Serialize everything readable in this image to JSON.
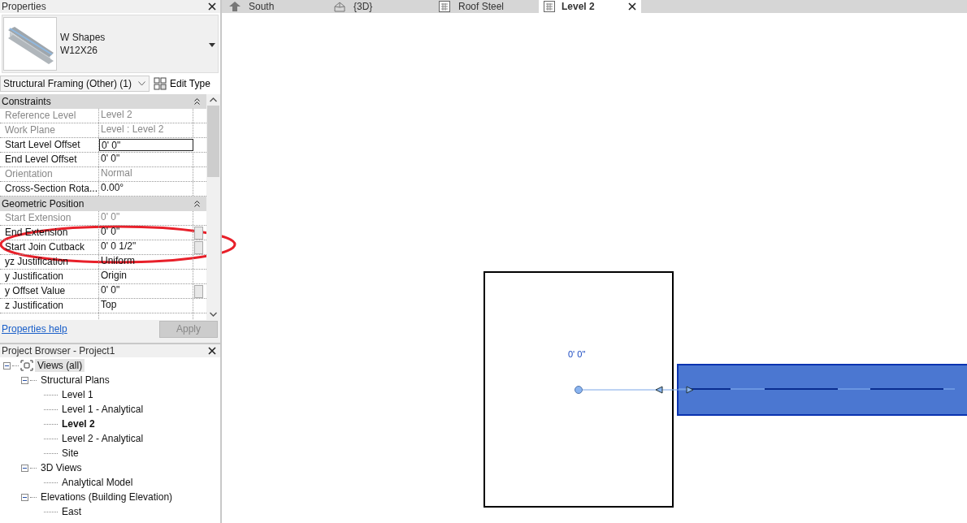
{
  "properties": {
    "title": "Properties",
    "type_family": "W Shapes",
    "type_name": "W12X26",
    "category_selector": "Structural Framing (Other) (1)",
    "edit_type": "Edit Type",
    "sections": [
      {
        "title": "Constraints",
        "expanded": true,
        "rows": [
          {
            "label": "Reference Level",
            "value": "Level 2",
            "disabled": true,
            "editing": false,
            "param_button": false
          },
          {
            "label": "Work Plane",
            "value": "Level : Level 2",
            "disabled": true,
            "editing": false,
            "param_button": false
          },
          {
            "label": "Start Level Offset",
            "value": "0'  0\"",
            "disabled": false,
            "editing": true,
            "param_button": false
          },
          {
            "label": "End Level Offset",
            "value": "0'  0\"",
            "disabled": false,
            "editing": false,
            "param_button": false
          },
          {
            "label": "Orientation",
            "value": "Normal",
            "disabled": true,
            "editing": false,
            "param_button": false
          },
          {
            "label": "Cross-Section Rota...",
            "value": "0.00°",
            "disabled": false,
            "editing": false,
            "param_button": false
          }
        ]
      },
      {
        "title": "Geometric Position",
        "expanded": true,
        "rows": [
          {
            "label": "Start Extension",
            "value": "0'  0\"",
            "disabled": true,
            "editing": false,
            "param_button": false
          },
          {
            "label": "End Extension",
            "value": "0'  0\"",
            "disabled": false,
            "editing": false,
            "param_button": true
          },
          {
            "label": "Start Join Cutback",
            "value": "0'  0 1/2\"",
            "disabled": false,
            "editing": false,
            "param_button": true
          },
          {
            "label": "yz Justification",
            "value": "Uniform",
            "disabled": false,
            "editing": false,
            "param_button": false
          },
          {
            "label": "y Justification",
            "value": "Origin",
            "disabled": false,
            "editing": false,
            "param_button": false
          },
          {
            "label": "y Offset Value",
            "value": "0'  0\"",
            "disabled": false,
            "editing": false,
            "param_button": true
          },
          {
            "label": "z Justification",
            "value": "Top",
            "disabled": false,
            "editing": false,
            "param_button": false
          }
        ]
      }
    ],
    "help_link": "Properties help",
    "apply_button": {
      "label": "Apply",
      "disabled": true
    }
  },
  "project_browser": {
    "title": "Project Browser - Project1",
    "tree": [
      {
        "label": "Views (all)",
        "selected": true,
        "active": false,
        "expanded": true,
        "children": [
          {
            "label": "Structural Plans",
            "selected": false,
            "active": false,
            "expanded": true,
            "children": [
              {
                "label": "Level 1",
                "selected": false,
                "active": false
              },
              {
                "label": "Level 1 - Analytical",
                "selected": false,
                "active": false
              },
              {
                "label": "Level 2",
                "selected": false,
                "active": true
              },
              {
                "label": "Level 2 - Analytical",
                "selected": false,
                "active": false
              },
              {
                "label": "Site",
                "selected": false,
                "active": false
              }
            ]
          },
          {
            "label": "3D Views",
            "selected": false,
            "active": false,
            "expanded": true,
            "children": [
              {
                "label": "Analytical Model",
                "selected": false,
                "active": false
              }
            ]
          },
          {
            "label": "Elevations (Building Elevation)",
            "selected": false,
            "active": false,
            "expanded": true,
            "children": [
              {
                "label": "East",
                "selected": false,
                "active": false
              }
            ]
          }
        ]
      }
    ]
  },
  "view_tabs": [
    {
      "label": "South",
      "kind": "elevation",
      "selected": false
    },
    {
      "label": "{3D}",
      "kind": "perspective",
      "selected": false
    },
    {
      "label": "Roof Steel",
      "kind": "plan",
      "selected": false
    },
    {
      "label": "Level 2",
      "kind": "plan",
      "selected": true
    }
  ],
  "canvas": {
    "dimension_label": "0'  0\""
  }
}
